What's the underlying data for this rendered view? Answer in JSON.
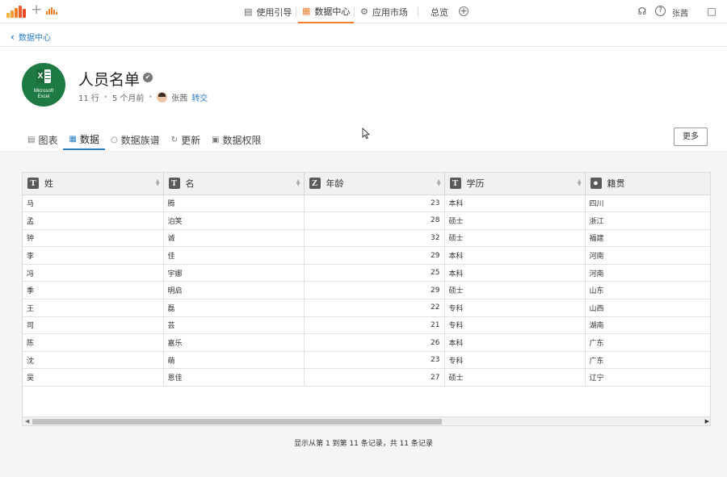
{
  "topbar": {
    "nav": [
      {
        "label": "使用引导",
        "icon": "guide-icon"
      },
      {
        "label": "数据中心",
        "icon": "document-icon",
        "active": true
      },
      {
        "label": "应用市场",
        "icon": "market-icon"
      }
    ],
    "overview": "总览",
    "user": "张茜",
    "accent": "#ef7c2e"
  },
  "breadcrumb": {
    "label": "数据中心"
  },
  "dataset": {
    "logo_line1": "Microsoft",
    "logo_line2": "Excel",
    "logo_letter": "X",
    "title": "人员名单",
    "rows": "11 行",
    "time": "5 个月前",
    "owner": "张茜",
    "transfer": "转交"
  },
  "tabs": [
    {
      "label": "图表",
      "icon": "chart-icon"
    },
    {
      "label": "数据",
      "icon": "table-icon",
      "active": true
    },
    {
      "label": "数据族谱",
      "icon": "lineage-icon"
    },
    {
      "label": "更新",
      "icon": "refresh-icon"
    },
    {
      "label": "数据权限",
      "icon": "lock-icon"
    }
  ],
  "more_button": "更多",
  "table": {
    "columns": [
      {
        "label": "姓",
        "type": "T"
      },
      {
        "label": "名",
        "type": "T"
      },
      {
        "label": "年龄",
        "type": "Z"
      },
      {
        "label": "学历",
        "type": "T"
      },
      {
        "label": "籍贯",
        "type": "location"
      }
    ],
    "rows": [
      [
        "马",
        "腾",
        "23",
        "本科",
        "四川"
      ],
      [
        "孟",
        "泊笑",
        "28",
        "硕士",
        "浙江"
      ],
      [
        "钟",
        "诚",
        "32",
        "硕士",
        "福建"
      ],
      [
        "李",
        "佳",
        "29",
        "本科",
        "河南"
      ],
      [
        "冯",
        "宇娜",
        "25",
        "本科",
        "河南"
      ],
      [
        "季",
        "明启",
        "29",
        "硕士",
        "山东"
      ],
      [
        "王",
        "磊",
        "22",
        "专科",
        "山西"
      ],
      [
        "司",
        "芸",
        "21",
        "专科",
        "湖南"
      ],
      [
        "陈",
        "嘉乐",
        "26",
        "本科",
        "广东"
      ],
      [
        "沈",
        "萌",
        "23",
        "专科",
        "广东"
      ],
      [
        "吴",
        "恩佳",
        "27",
        "硕士",
        "辽宁"
      ]
    ]
  },
  "footer": "显示从第 1 到第 11 条记录，共 11 条记录"
}
